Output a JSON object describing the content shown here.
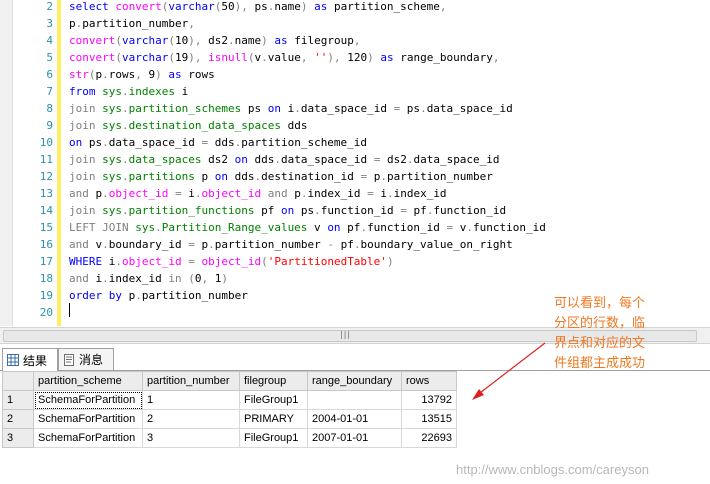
{
  "editor": {
    "line_numbers": [
      "2",
      "3",
      "4",
      "5",
      "6",
      "7",
      "8",
      "9",
      "10",
      "11",
      "12",
      "13",
      "14",
      "15",
      "16",
      "17",
      "18",
      "19",
      "20"
    ],
    "lines": [
      [
        {
          "c": "kw",
          "t": "select "
        },
        {
          "c": "fn",
          "t": "convert"
        },
        {
          "c": "gr",
          "t": "("
        },
        {
          "c": "kw",
          "t": "varchar"
        },
        {
          "c": "gr",
          "t": "("
        },
        {
          "c": "tx",
          "t": "50"
        },
        {
          "c": "gr",
          "t": "),"
        },
        {
          "c": "tx",
          "t": " ps"
        },
        {
          "c": "gr",
          "t": "."
        },
        {
          "c": "tx",
          "t": "name"
        },
        {
          "c": "gr",
          "t": ")"
        },
        {
          "c": "kw",
          "t": " as"
        },
        {
          "c": "tx",
          "t": " partition_scheme"
        },
        {
          "c": "gr",
          "t": ","
        }
      ],
      [
        {
          "c": "tx",
          "t": "p"
        },
        {
          "c": "gr",
          "t": "."
        },
        {
          "c": "tx",
          "t": "partition_number"
        },
        {
          "c": "gr",
          "t": ","
        }
      ],
      [
        {
          "c": "fn",
          "t": "convert"
        },
        {
          "c": "gr",
          "t": "("
        },
        {
          "c": "kw",
          "t": "varchar"
        },
        {
          "c": "gr",
          "t": "("
        },
        {
          "c": "tx",
          "t": "10"
        },
        {
          "c": "gr",
          "t": "),"
        },
        {
          "c": "tx",
          "t": " ds2"
        },
        {
          "c": "gr",
          "t": "."
        },
        {
          "c": "tx",
          "t": "name"
        },
        {
          "c": "gr",
          "t": ")"
        },
        {
          "c": "kw",
          "t": " as"
        },
        {
          "c": "tx",
          "t": " filegroup"
        },
        {
          "c": "gr",
          "t": ","
        }
      ],
      [
        {
          "c": "fn",
          "t": "convert"
        },
        {
          "c": "gr",
          "t": "("
        },
        {
          "c": "kw",
          "t": "varchar"
        },
        {
          "c": "gr",
          "t": "("
        },
        {
          "c": "tx",
          "t": "19"
        },
        {
          "c": "gr",
          "t": "),"
        },
        {
          "c": "fn",
          "t": " isnull"
        },
        {
          "c": "gr",
          "t": "("
        },
        {
          "c": "tx",
          "t": "v"
        },
        {
          "c": "gr",
          "t": "."
        },
        {
          "c": "tx",
          "t": "value"
        },
        {
          "c": "gr",
          "t": ","
        },
        {
          "c": "st",
          "t": " ''"
        },
        {
          "c": "gr",
          "t": "),"
        },
        {
          "c": "tx",
          "t": " 120"
        },
        {
          "c": "gr",
          "t": ")"
        },
        {
          "c": "kw",
          "t": " as"
        },
        {
          "c": "tx",
          "t": " range_boundary"
        },
        {
          "c": "gr",
          "t": ","
        }
      ],
      [
        {
          "c": "fn",
          "t": "str"
        },
        {
          "c": "gr",
          "t": "("
        },
        {
          "c": "tx",
          "t": "p"
        },
        {
          "c": "gr",
          "t": "."
        },
        {
          "c": "tx",
          "t": "rows"
        },
        {
          "c": "gr",
          "t": ","
        },
        {
          "c": "tx",
          "t": " 9"
        },
        {
          "c": "gr",
          "t": ")"
        },
        {
          "c": "kw",
          "t": " as"
        },
        {
          "c": "tx",
          "t": " rows"
        }
      ],
      [
        {
          "c": "kw",
          "t": "from "
        },
        {
          "c": "sys",
          "t": "sys"
        },
        {
          "c": "gr",
          "t": "."
        },
        {
          "c": "sys",
          "t": "indexes"
        },
        {
          "c": "tx",
          "t": " i"
        }
      ],
      [
        {
          "c": "gr",
          "t": "join "
        },
        {
          "c": "sys",
          "t": "sys"
        },
        {
          "c": "gr",
          "t": "."
        },
        {
          "c": "sys",
          "t": "partition_schemes"
        },
        {
          "c": "tx",
          "t": " ps "
        },
        {
          "c": "kw",
          "t": "on"
        },
        {
          "c": "tx",
          "t": " i"
        },
        {
          "c": "gr",
          "t": "."
        },
        {
          "c": "tx",
          "t": "data_space_id "
        },
        {
          "c": "gr",
          "t": "="
        },
        {
          "c": "tx",
          "t": " ps"
        },
        {
          "c": "gr",
          "t": "."
        },
        {
          "c": "tx",
          "t": "data_space_id"
        }
      ],
      [
        {
          "c": "gr",
          "t": "join "
        },
        {
          "c": "sys",
          "t": "sys"
        },
        {
          "c": "gr",
          "t": "."
        },
        {
          "c": "sys",
          "t": "destination_data_spaces"
        },
        {
          "c": "tx",
          "t": " dds"
        }
      ],
      [
        {
          "c": "kw",
          "t": "on"
        },
        {
          "c": "tx",
          "t": " ps"
        },
        {
          "c": "gr",
          "t": "."
        },
        {
          "c": "tx",
          "t": "data_space_id "
        },
        {
          "c": "gr",
          "t": "="
        },
        {
          "c": "tx",
          "t": " dds"
        },
        {
          "c": "gr",
          "t": "."
        },
        {
          "c": "tx",
          "t": "partition_scheme_id"
        }
      ],
      [
        {
          "c": "gr",
          "t": "join "
        },
        {
          "c": "sys",
          "t": "sys"
        },
        {
          "c": "gr",
          "t": "."
        },
        {
          "c": "sys",
          "t": "data_spaces"
        },
        {
          "c": "tx",
          "t": " ds2 "
        },
        {
          "c": "kw",
          "t": "on"
        },
        {
          "c": "tx",
          "t": " dds"
        },
        {
          "c": "gr",
          "t": "."
        },
        {
          "c": "tx",
          "t": "data_space_id "
        },
        {
          "c": "gr",
          "t": "="
        },
        {
          "c": "tx",
          "t": " ds2"
        },
        {
          "c": "gr",
          "t": "."
        },
        {
          "c": "tx",
          "t": "data_space_id"
        }
      ],
      [
        {
          "c": "gr",
          "t": "join "
        },
        {
          "c": "sys",
          "t": "sys"
        },
        {
          "c": "gr",
          "t": "."
        },
        {
          "c": "sys",
          "t": "partitions"
        },
        {
          "c": "tx",
          "t": " p "
        },
        {
          "c": "kw",
          "t": "on"
        },
        {
          "c": "tx",
          "t": " dds"
        },
        {
          "c": "gr",
          "t": "."
        },
        {
          "c": "tx",
          "t": "destination_id "
        },
        {
          "c": "gr",
          "t": "="
        },
        {
          "c": "tx",
          "t": " p"
        },
        {
          "c": "gr",
          "t": "."
        },
        {
          "c": "tx",
          "t": "partition_number"
        }
      ],
      [
        {
          "c": "gr",
          "t": "and "
        },
        {
          "c": "tx",
          "t": "p"
        },
        {
          "c": "gr",
          "t": "."
        },
        {
          "c": "fn",
          "t": "object_id "
        },
        {
          "c": "gr",
          "t": "="
        },
        {
          "c": "tx",
          "t": " i"
        },
        {
          "c": "gr",
          "t": "."
        },
        {
          "c": "fn",
          "t": "object_id "
        },
        {
          "c": "gr",
          "t": "and"
        },
        {
          "c": "tx",
          "t": " p"
        },
        {
          "c": "gr",
          "t": "."
        },
        {
          "c": "tx",
          "t": "index_id "
        },
        {
          "c": "gr",
          "t": "="
        },
        {
          "c": "tx",
          "t": " i"
        },
        {
          "c": "gr",
          "t": "."
        },
        {
          "c": "tx",
          "t": "index_id"
        }
      ],
      [
        {
          "c": "gr",
          "t": "join "
        },
        {
          "c": "sys",
          "t": "sys"
        },
        {
          "c": "gr",
          "t": "."
        },
        {
          "c": "sys",
          "t": "partition_functions"
        },
        {
          "c": "tx",
          "t": " pf "
        },
        {
          "c": "kw",
          "t": "on"
        },
        {
          "c": "tx",
          "t": " ps"
        },
        {
          "c": "gr",
          "t": "."
        },
        {
          "c": "tx",
          "t": "function_id "
        },
        {
          "c": "gr",
          "t": "="
        },
        {
          "c": "tx",
          "t": " pf"
        },
        {
          "c": "gr",
          "t": "."
        },
        {
          "c": "tx",
          "t": "function_id"
        }
      ],
      [
        {
          "c": "gr",
          "t": "LEFT JOIN "
        },
        {
          "c": "sys",
          "t": "sys"
        },
        {
          "c": "gr",
          "t": "."
        },
        {
          "c": "sys",
          "t": "Partition_Range_values"
        },
        {
          "c": "tx",
          "t": " v "
        },
        {
          "c": "kw",
          "t": "on"
        },
        {
          "c": "tx",
          "t": " pf"
        },
        {
          "c": "gr",
          "t": "."
        },
        {
          "c": "tx",
          "t": "function_id "
        },
        {
          "c": "gr",
          "t": "="
        },
        {
          "c": "tx",
          "t": " v"
        },
        {
          "c": "gr",
          "t": "."
        },
        {
          "c": "tx",
          "t": "function_id"
        }
      ],
      [
        {
          "c": "gr",
          "t": "and "
        },
        {
          "c": "tx",
          "t": "v"
        },
        {
          "c": "gr",
          "t": "."
        },
        {
          "c": "tx",
          "t": "boundary_id "
        },
        {
          "c": "gr",
          "t": "="
        },
        {
          "c": "tx",
          "t": " p"
        },
        {
          "c": "gr",
          "t": "."
        },
        {
          "c": "tx",
          "t": "partition_number "
        },
        {
          "c": "gr",
          "t": "-"
        },
        {
          "c": "tx",
          "t": " pf"
        },
        {
          "c": "gr",
          "t": "."
        },
        {
          "c": "tx",
          "t": "boundary_value_on_right"
        }
      ],
      [
        {
          "c": "kw",
          "t": "WHERE "
        },
        {
          "c": "tx",
          "t": "i"
        },
        {
          "c": "gr",
          "t": "."
        },
        {
          "c": "fn",
          "t": "object_id "
        },
        {
          "c": "gr",
          "t": "="
        },
        {
          "c": "fn",
          "t": " object_id"
        },
        {
          "c": "gr",
          "t": "("
        },
        {
          "c": "st",
          "t": "'PartitionedTable'"
        },
        {
          "c": "gr",
          "t": ")"
        }
      ],
      [
        {
          "c": "gr",
          "t": "and "
        },
        {
          "c": "tx",
          "t": "i"
        },
        {
          "c": "gr",
          "t": "."
        },
        {
          "c": "tx",
          "t": "index_id "
        },
        {
          "c": "gr",
          "t": "in"
        },
        {
          "c": "tx",
          "t": " "
        },
        {
          "c": "gr",
          "t": "("
        },
        {
          "c": "tx",
          "t": "0"
        },
        {
          "c": "gr",
          "t": ","
        },
        {
          "c": "tx",
          "t": " 1"
        },
        {
          "c": "gr",
          "t": ")"
        }
      ],
      [
        {
          "c": "kw",
          "t": "order by "
        },
        {
          "c": "tx",
          "t": "p"
        },
        {
          "c": "gr",
          "t": "."
        },
        {
          "c": "tx",
          "t": "partition_number"
        }
      ],
      []
    ]
  },
  "results_tabs": [
    {
      "label": "结果",
      "icon": "grid-icon",
      "active": true
    },
    {
      "label": "消息",
      "icon": "messages-icon",
      "active": false
    }
  ],
  "grid": {
    "columns": [
      "partition_scheme",
      "partition_number",
      "filegroup",
      "range_boundary",
      "rows"
    ],
    "rows": [
      {
        "n": "1",
        "cells": [
          "SchemaForPartition",
          "1",
          "FileGroup1",
          "",
          "13792"
        ]
      },
      {
        "n": "2",
        "cells": [
          "SchemaForPartition",
          "2",
          "PRIMARY",
          "2004-01-01",
          "13515"
        ]
      },
      {
        "n": "3",
        "cells": [
          "SchemaForPartition",
          "3",
          "FileGroup1",
          "2007-01-01",
          "22693"
        ]
      }
    ]
  },
  "annotation": {
    "text": "可以看到，每个分区的行数，临界点和对应的文件组都主成成功",
    "color": "#f07820"
  },
  "watermark": "http://www.cnblogs.com/careyson",
  "colors": {
    "keyword": "#0000ff",
    "function": "#ff00ff",
    "system_object": "#008000",
    "operator": "#808080",
    "string": "#ff0000",
    "line_number": "#2b91af"
  }
}
